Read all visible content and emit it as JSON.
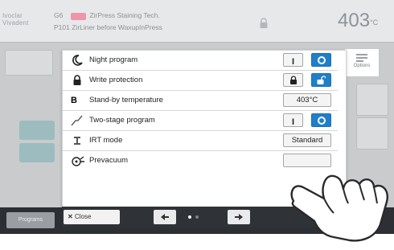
{
  "header": {
    "logo_text": "Ivoclar Vivadent",
    "line1_prefix": "G6",
    "line1_badge": "",
    "line1_text": "ZirPress Staining Tech.",
    "line2_prefix": "P101",
    "line2_text": "ZirLiner before WaxupInPress",
    "temperature": "403",
    "temperature_unit": "°C"
  },
  "background": {
    "programs_label": "Programs"
  },
  "dialog": {
    "rows": [
      {
        "label": "Night program",
        "icon": "moon-icon"
      },
      {
        "label": "Write protection",
        "icon": "lock-icon"
      },
      {
        "label": "Stand-by temperature",
        "icon": "b-letter-icon",
        "value": "403°C"
      },
      {
        "label": "Two-stage program",
        "icon": "two-stage-curve-icon"
      },
      {
        "label": "IRT mode",
        "icon": "irt-icon",
        "value": "Standard"
      },
      {
        "label": "Prevacuum",
        "icon": "vacuum-pump-icon"
      }
    ],
    "toggle_on_label": "I",
    "stand_by_value": "403°C",
    "irt_value": "Standard",
    "close_label": "Close",
    "options_tab_label": "Options"
  },
  "colors": {
    "accent_blue": "#1f7fc9",
    "bottom_bar": "#2c2f33",
    "tile_green": "#9cbcc0"
  }
}
